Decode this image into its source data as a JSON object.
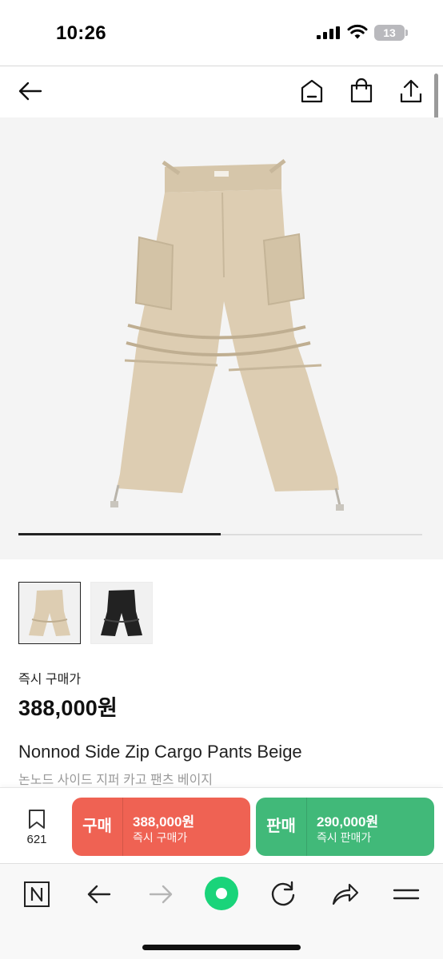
{
  "status_bar": {
    "time": "10:26",
    "battery": "13"
  },
  "header": {
    "back_icon": "arrow-left-icon",
    "home_icon": "home-icon",
    "cart_icon": "shopping-bag-icon",
    "share_icon": "share-icon"
  },
  "gallery": {
    "slide": 1,
    "slide_count": 2,
    "progress": 0.5
  },
  "thumbnails": [
    {
      "color": "beige",
      "selected": true
    },
    {
      "color": "black",
      "selected": false
    }
  ],
  "price": {
    "label": "즉시 구매가",
    "value": "388,000원"
  },
  "product": {
    "name": "Nonnod Side Zip Cargo Pants Beige",
    "name_ko": "논노드 사이드 지퍼 카고 팬츠 베이지"
  },
  "actions": {
    "wish_count": "621",
    "buy": {
      "label": "구매",
      "price": "388,000원",
      "sub": "즉시 구매가"
    },
    "sell": {
      "label": "판매",
      "price": "290,000원",
      "sub": "즉시 판매가"
    }
  },
  "browser_toolbar": {
    "items": [
      "naver-n-icon",
      "back-arrow-icon",
      "forward-arrow-icon",
      "green-dot-icon",
      "reload-icon",
      "share-arrow-icon",
      "menu-icon"
    ]
  },
  "colors": {
    "buy": "#ef6253",
    "sell": "#41b979",
    "beige": "#ddcdb2",
    "black": "#222222"
  }
}
